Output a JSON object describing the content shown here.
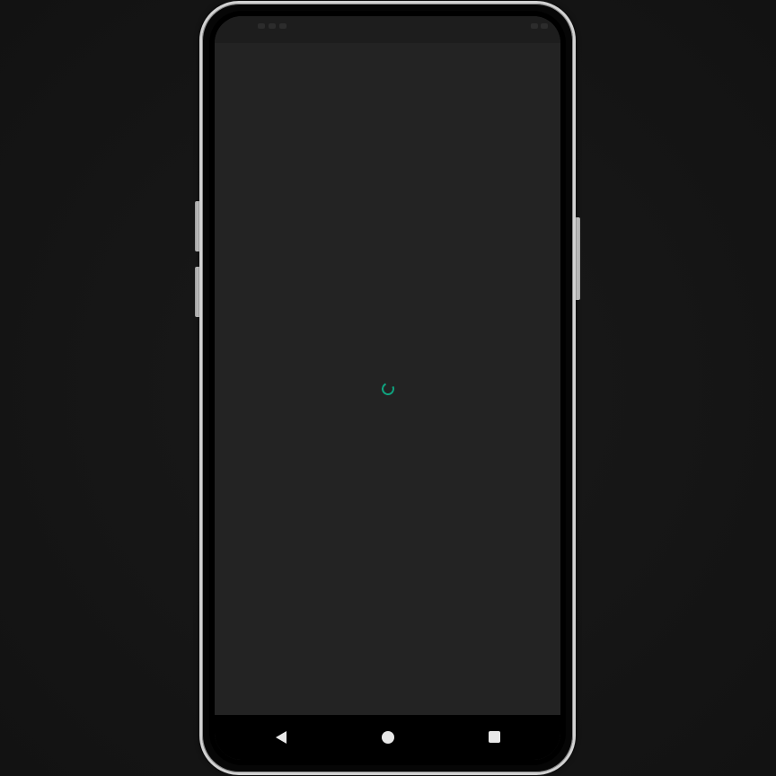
{
  "device": {
    "frame_color": "#d2d2d2",
    "screen_background": "#232323"
  },
  "status_bar": {
    "icons": [
      "status-icon",
      "status-icon",
      "status-icon"
    ],
    "time": ""
  },
  "content": {
    "loading_indicator": "spinner-icon",
    "accent_color": "#0fa37f"
  },
  "navigation_bar": {
    "back_icon": "back-triangle-icon",
    "home_icon": "home-circle-icon",
    "recents_icon": "recents-square-icon"
  }
}
